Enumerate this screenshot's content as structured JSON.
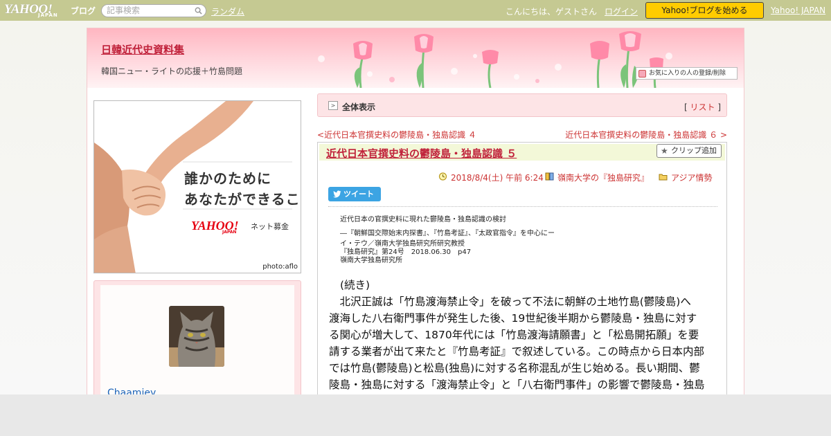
{
  "topbar": {
    "logo_main": "YAHOO!",
    "logo_sub": "JAPAN",
    "logo_blog": "ブログ",
    "search_placeholder": "記事検索",
    "random_link": "ランダム",
    "greeting": "こんにちは、ゲストさん",
    "login_link": "ログイン",
    "start_button": "Yahoo!ブログを始める",
    "yahoo_japan_link": "Yahoo! JAPAN"
  },
  "header": {
    "blog_title": "日韓近代史資料集",
    "blog_description": "韓国ニュー・ライトの応援＋竹島問題",
    "favorite_button": "お気に入りの人の登録/削除"
  },
  "sidebar": {
    "ad": {
      "line1": "誰かのために",
      "line2": "あなたができること",
      "logo": "YAHOO!",
      "logo_sub": "JAPAN",
      "logo_text": "ネット募金",
      "credit": "photo:aflo"
    },
    "profile": {
      "name": "Chaamiey"
    }
  },
  "main": {
    "allview_label": "全体表示",
    "list_open": "[",
    "list_link": "リスト",
    "list_close": "]",
    "prev_arrow": "<",
    "prev_link": "近代日本官撰史料の鬱陵島・独島認識 ４",
    "next_link": "近代日本官撰史料の鬱陵島・独島認識 ６",
    "next_arrow": ">"
  },
  "article": {
    "title": "近代日本官撰史料の鬱陵島・独島認識 ５",
    "clip_button": "クリップ追加",
    "date": "2018/8/4(土) 午前 6:24",
    "book_category": "嶺南大学の『独島研究』",
    "folder_category": "アジア情勢",
    "tweet_button": "ツイート",
    "citation": [
      "近代日本の官撰史料に現れた鬱陵島・独島認識の検討",
      "―『朝鮮国交際始末内探書』、『竹島考証』、『太政官指令』を中心にー",
      "イ・テウ／嶺南大学独島研究所研究教授",
      "『独島研究』第24号　2018.06.30　p47",
      "嶺南大学独島研究所"
    ],
    "body": [
      "(続き)",
      "　北沢正誠は「竹島渡海禁止令」を破って不法に朝鮮の土地竹島(鬱陵島)へ",
      "渡海した八右衛門事件が発生した後、19世紀後半期から鬱陵島・独島に対す",
      "る関心が増大して、1870年代には「竹島渡海請願書」と「松島開拓願」を要",
      "請する業者が出て来たと『竹島考証』で叙述している。この時点から日本内部",
      "では竹島(鬱陵島)と松島(独島)に対する名称混乱が生じ始める。長い期間、鬱",
      "陵島・独島に対する「渡海禁止令」と「八右衛門事件」の影響で鬱陵島・独島"
    ]
  },
  "colors": {
    "topbar": "#c5c992",
    "accent_red": "#c0213a",
    "start_button": "#ffcc00",
    "twitter": "#3ca4e3"
  }
}
